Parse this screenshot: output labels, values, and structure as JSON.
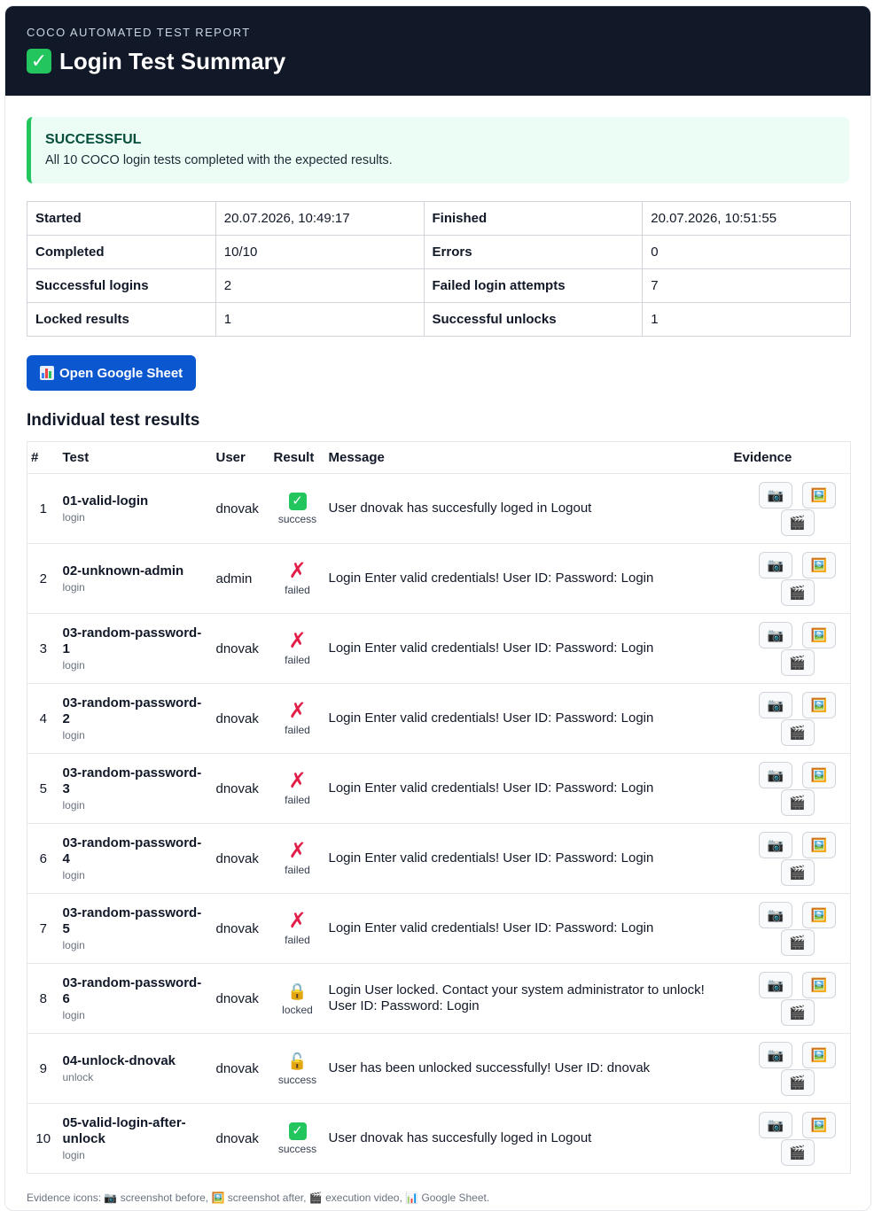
{
  "header": {
    "kicker": "COCO AUTOMATED TEST REPORT",
    "title": "Login Test Summary"
  },
  "banner": {
    "title": "SUCCESSFUL",
    "text": "All 10 COCO login tests completed with the expected results."
  },
  "summary": [
    {
      "k1": "Started",
      "v1": "20.07.2026, 10:49:17",
      "k2": "Finished",
      "v2": "20.07.2026, 10:51:55"
    },
    {
      "k1": "Completed",
      "v1": "10/10",
      "k2": "Errors",
      "v2": "0"
    },
    {
      "k1": "Successful logins",
      "v1": "2",
      "k2": "Failed login attempts",
      "v2": "7"
    },
    {
      "k1": "Locked results",
      "v1": "1",
      "k2": "Successful unlocks",
      "v2": "1"
    }
  ],
  "sheet_button": "Open Google Sheet",
  "results_title": "Individual test results",
  "columns": {
    "num": "#",
    "test": "Test",
    "user": "User",
    "result": "Result",
    "message": "Message",
    "evidence": "Evidence"
  },
  "rows": [
    {
      "num": "1",
      "name": "01-valid-login",
      "type": "login",
      "user": "dnovak",
      "status": "success",
      "icon": "check",
      "message": "User dnovak has succesfully loged in Logout"
    },
    {
      "num": "2",
      "name": "02-unknown-admin",
      "type": "login",
      "user": "admin",
      "status": "failed",
      "icon": "cross",
      "message": "Login Enter valid credentials! User ID: Password: Login"
    },
    {
      "num": "3",
      "name": "03-random-password-1",
      "type": "login",
      "user": "dnovak",
      "status": "failed",
      "icon": "cross",
      "message": "Login Enter valid credentials! User ID: Password: Login"
    },
    {
      "num": "4",
      "name": "03-random-password-2",
      "type": "login",
      "user": "dnovak",
      "status": "failed",
      "icon": "cross",
      "message": "Login Enter valid credentials! User ID: Password: Login"
    },
    {
      "num": "5",
      "name": "03-random-password-3",
      "type": "login",
      "user": "dnovak",
      "status": "failed",
      "icon": "cross",
      "message": "Login Enter valid credentials! User ID: Password: Login"
    },
    {
      "num": "6",
      "name": "03-random-password-4",
      "type": "login",
      "user": "dnovak",
      "status": "failed",
      "icon": "cross",
      "message": "Login Enter valid credentials! User ID: Password: Login"
    },
    {
      "num": "7",
      "name": "03-random-password-5",
      "type": "login",
      "user": "dnovak",
      "status": "failed",
      "icon": "cross",
      "message": "Login Enter valid credentials! User ID: Password: Login"
    },
    {
      "num": "8",
      "name": "03-random-password-6",
      "type": "login",
      "user": "dnovak",
      "status": "locked",
      "icon": "lock",
      "message": "Login User locked. Contact your system administrator to unlock! User ID: Password: Login"
    },
    {
      "num": "9",
      "name": "04-unlock-dnovak",
      "type": "unlock",
      "user": "dnovak",
      "status": "success",
      "icon": "unlock",
      "message": "User has been unlocked successfully! User ID: dnovak"
    },
    {
      "num": "10",
      "name": "05-valid-login-after-unlock",
      "type": "login",
      "user": "dnovak",
      "status": "success",
      "icon": "check",
      "message": "User dnovak has succesfully loged in Logout"
    }
  ],
  "footer": {
    "prefix": "Evidence icons:",
    "before": "screenshot before,",
    "after": "screenshot after,",
    "video": "execution video,",
    "sheet": "Google Sheet."
  },
  "colors": {
    "header_bg": "#111827",
    "success": "#22c55e",
    "button": "#0b57d0",
    "failed": "#e11d48"
  }
}
